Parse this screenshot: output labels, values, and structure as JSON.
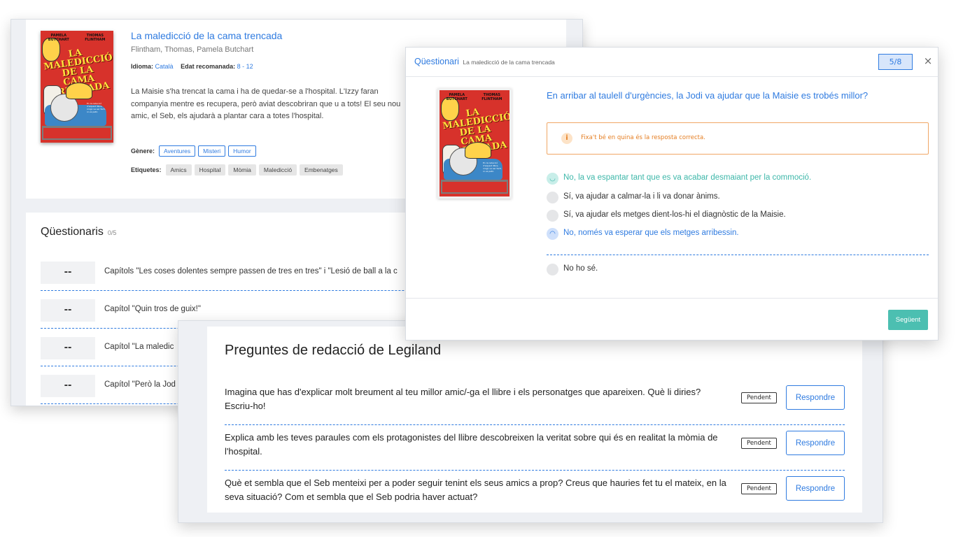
{
  "book": {
    "title": "La maledicció de la cama trencada",
    "authors": "Flintham, Thomas, Pamela Butchart",
    "language_label": "Idioma:",
    "language": "Català",
    "age_label": "Edat recomanada:",
    "age": "8 - 12",
    "description": "La Maisie s'ha trencat la cama i ha de quedar-se a l'hospital. L'Izzy faran companyia mentre es recupera, però aviat descobriran que u a tots! El seu nou amic, el Seb, els ajudarà a plantar cara a totes l'hospital.",
    "genre_label": "Gènere:",
    "genres": [
      "Aventures",
      "Misteri",
      "Humor"
    ],
    "tags_label": "Etiquetes:",
    "tags": [
      "Amics",
      "Hospital",
      "Mòmia",
      "Maledicció",
      "Embenatges"
    ],
    "cover": {
      "authors_left": "PAMELA BUTCHART",
      "authors_right": "THOMAS FLINTHAM",
      "title": "LA MALEDICCIÓ DE LA CAMA TRENCADA",
      "blurb": "En la redacció d'aquest llibre, ningú va ser ferit, ni va patir."
    }
  },
  "questionnaires": {
    "heading": "Qüestionaris",
    "count": "0/5",
    "items": [
      {
        "score": "--",
        "title": "Capítols \"Les coses dolentes sempre passen de tres en tres\" i \"Lesió de ball a la c"
      },
      {
        "score": "--",
        "title": "Capítol \"Quin tros de guix!\""
      },
      {
        "score": "--",
        "title": "Capítol \"La maledic"
      },
      {
        "score": "--",
        "title": "Capítol \"Però la Jod"
      }
    ]
  },
  "writing": {
    "title": "Preguntes de redacció de Legiland",
    "items": [
      {
        "text": "Imagina que has d'explicar molt breument al teu millor amic/-ga el llibre i els personatges que apareixen. Què li diries? Escriu-ho!",
        "status": "Pendent",
        "action": "Respondre"
      },
      {
        "text": "Explica amb les teves paraules com els protagonistes del llibre descobreixen la veritat sobre qui és en realitat la mòmia de l'hospital.",
        "status": "Pendent",
        "action": "Respondre"
      },
      {
        "text": "Què et sembla que el Seb menteixi per a poder seguir tenint els seus amics a prop? Creus que hauries fet tu el mateix, en la seva situació? Com et sembla que el Seb podria haver actuat?",
        "status": "Pendent",
        "action": "Respondre"
      }
    ]
  },
  "quiz": {
    "title": "Qüestionari",
    "subtitle": "La maledicció de la cama trencada",
    "progress": "5/8",
    "close_glyph": "×",
    "question": "En arribar al taulell d'urgències, la Jodi va ajudar que la Maisie es trobés millor?",
    "hint_icon": "i",
    "hint": "Fixa't bé en quina és la resposta correcta.",
    "options": [
      {
        "text": "No, la va espantar tant que es va acabar desmaiant per la commoció.",
        "state": "correct",
        "glyph": "◡"
      },
      {
        "text": "Sí, va ajudar a calmar-la i li va donar ànims.",
        "state": "none",
        "glyph": ""
      },
      {
        "text": "Sí, va ajudar els metges dient-los-hi el diagnòstic de la Maisie.",
        "state": "none",
        "glyph": ""
      },
      {
        "text": "No, només va esperar que els metges arribessin.",
        "state": "wrong",
        "glyph": "◠"
      }
    ],
    "dont_know": "No ho sé.",
    "next": "Següent"
  },
  "colors": {
    "accent": "#2f7be0",
    "success": "#4cbfb1",
    "warning": "#e57e22",
    "cover_red": "#d7322b"
  }
}
